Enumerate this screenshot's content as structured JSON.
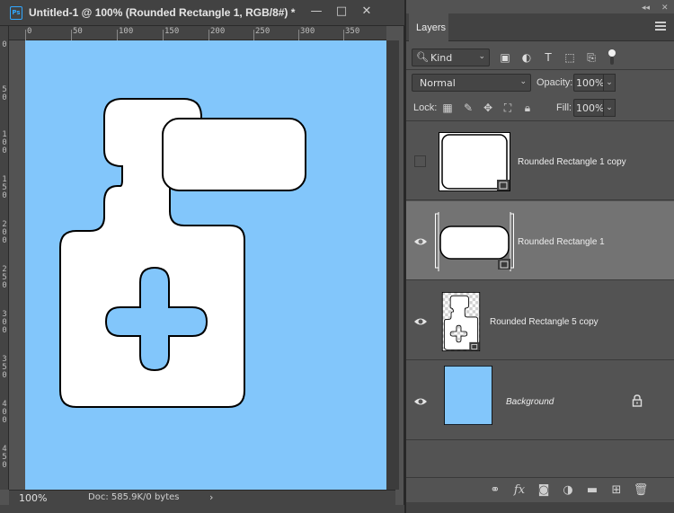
{
  "document": {
    "app_badge": "Ps",
    "title": "Untitled-1 @ 100% (Rounded Rectangle 1, RGB/8#) *",
    "zoom": "100%",
    "doc_info": "Doc: 585.9K/0 bytes",
    "canvas_color": "#82c6fb",
    "ruler_h_labels": [
      "0",
      "50",
      "100",
      "150",
      "200",
      "250",
      "300",
      "350"
    ],
    "ruler_v_labels": [
      "0",
      "50",
      "100",
      "150",
      "200",
      "250",
      "300",
      "350",
      "400",
      "450"
    ]
  },
  "window_controls": {
    "minimize": "—",
    "maximize": "□",
    "close": "✕"
  },
  "layers_panel": {
    "tab_label": "Layers",
    "filter_kind": "Kind",
    "blend_mode": "Normal",
    "opacity_label": "Opacity:",
    "opacity_value": "100%",
    "lock_label": "Lock:",
    "fill_label": "Fill:",
    "fill_value": "100%",
    "layers": [
      {
        "name": "Rounded Rectangle 1 copy",
        "visible": false,
        "selected": false
      },
      {
        "name": "Rounded Rectangle 1",
        "visible": true,
        "selected": true
      },
      {
        "name": "Rounded Rectangle 5 copy",
        "visible": true,
        "selected": false
      },
      {
        "name": "Background",
        "visible": true,
        "selected": false,
        "locked": true
      }
    ],
    "footer_icons": [
      "link-icon",
      "fx-icon",
      "mask-icon",
      "adjustment-icon",
      "folder-icon",
      "new-layer-icon",
      "trash-icon"
    ]
  }
}
